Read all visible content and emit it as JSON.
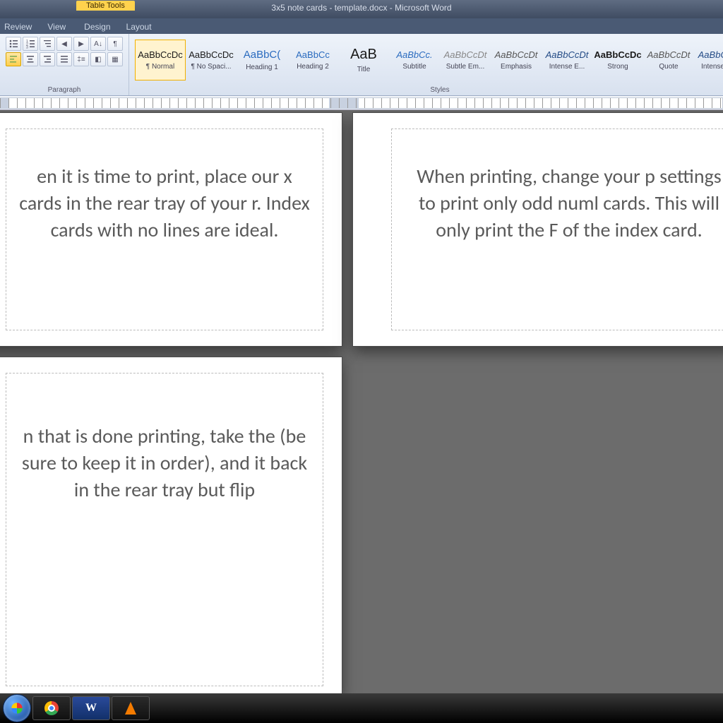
{
  "title": {
    "document": "3x5 note cards - template.docx - Microsoft Word"
  },
  "tabletools": {
    "label": "Table Tools",
    "design": "Design",
    "layout": "Layout"
  },
  "tabs": {
    "review": "Review",
    "view": "View"
  },
  "ribbon": {
    "paragraph_label": "Paragraph",
    "styles_label": "Styles",
    "styles": [
      {
        "preview": "AaBbCcDc",
        "label": "¶ Normal"
      },
      {
        "preview": "AaBbCcDc",
        "label": "¶ No Spaci..."
      },
      {
        "preview": "AaBbC(",
        "label": "Heading 1"
      },
      {
        "preview": "AaBbCc",
        "label": "Heading 2"
      },
      {
        "preview": "AaB",
        "label": "Title"
      },
      {
        "preview": "AaBbCc.",
        "label": "Subtitle"
      },
      {
        "preview": "AaBbCcDt",
        "label": "Subtle Em..."
      },
      {
        "preview": "AaBbCcDt",
        "label": "Emphasis"
      },
      {
        "preview": "AaBbCcDt",
        "label": "Intense E..."
      },
      {
        "preview": "AaBbCcDc",
        "label": "Strong"
      },
      {
        "preview": "AaBbCcDt",
        "label": "Quote"
      },
      {
        "preview": "AaBbCcDt",
        "label": "Intense Q..."
      }
    ]
  },
  "cards": {
    "c1": "en it is time to print, place our x cards in the rear tray of your r.  Index cards with no lines are ideal.",
    "c2": "When printing, change your p settings to print only odd numl cards.  This will only print the F of the index card.",
    "c3": "n that is done printing, take the (be sure to keep it in order), and it back in the rear tray but flip"
  },
  "taskbar": {
    "word_label": "W"
  }
}
